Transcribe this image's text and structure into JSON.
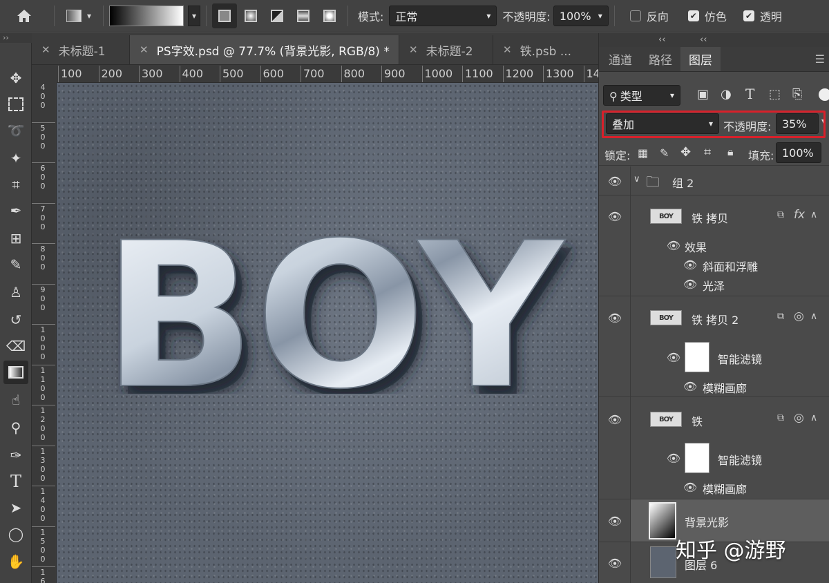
{
  "options_bar": {
    "mode_label": "模式:",
    "mode_value": "正常",
    "opacity_label": "不透明度:",
    "opacity_value": "100%",
    "reverse_label": "反向",
    "reverse_checked": false,
    "dither_label": "仿色",
    "dither_checked": true,
    "transparency_label": "透明",
    "transparency_checked": true
  },
  "tabs": [
    {
      "label": "未标题-1",
      "active": false
    },
    {
      "label": "PS字效.psd @ 77.7% (背景光影, RGB/8) *",
      "active": true
    },
    {
      "label": "未标题-2",
      "active": false
    },
    {
      "label": "铁.psb ...",
      "active": false
    }
  ],
  "ruler": {
    "h_labels": [
      "100",
      "200",
      "300",
      "400",
      "500",
      "600",
      "700",
      "800",
      "900",
      "1000",
      "1100",
      "1200",
      "1300",
      "14"
    ],
    "v_labels": [
      "4\n0\n0",
      "5\n0\n0",
      "6\n0\n0",
      "7\n0\n0",
      "8\n0\n0",
      "9\n0\n0",
      "1\n0\n0\n0",
      "1\n1\n0\n0",
      "1\n2\n0\n0",
      "1\n3\n0\n0",
      "1\n4\n0\n0",
      "1\n5\n0\n0",
      "1\n6"
    ]
  },
  "canvas": {
    "artwork_text": "BOY"
  },
  "panel": {
    "top_arrows": "‹‹",
    "tabs": [
      {
        "label": "通道",
        "active": false
      },
      {
        "label": "路径",
        "active": false
      },
      {
        "label": "图层",
        "active": true
      }
    ],
    "filter_label": "类型",
    "blend_mode": "叠加",
    "opacity_label": "不透明度:",
    "opacity_value": "35%",
    "lock_label": "锁定:",
    "fill_label": "填充:",
    "fill_value": "100%"
  },
  "layers": {
    "group": "组 2",
    "iron_copy": "铁 拷贝",
    "thumb_text": "BOY",
    "effects": "效果",
    "bevel": "斜面和浮雕",
    "satin": "光泽",
    "iron_copy2": "铁 拷贝 2",
    "smart_filters": "智能滤镜",
    "gallery": "模糊画廊",
    "iron": "铁",
    "smart_filters2": "智能滤镜",
    "gallery2": "模糊画廊",
    "bg_light": "背景光影",
    "layer6": "图层 6"
  },
  "watermark": "知乎 @游野",
  "colors": {
    "highlight_box": "#d9202a",
    "panel_bg": "#4a4a4a",
    "selected_layer": "#5e5e5e"
  }
}
